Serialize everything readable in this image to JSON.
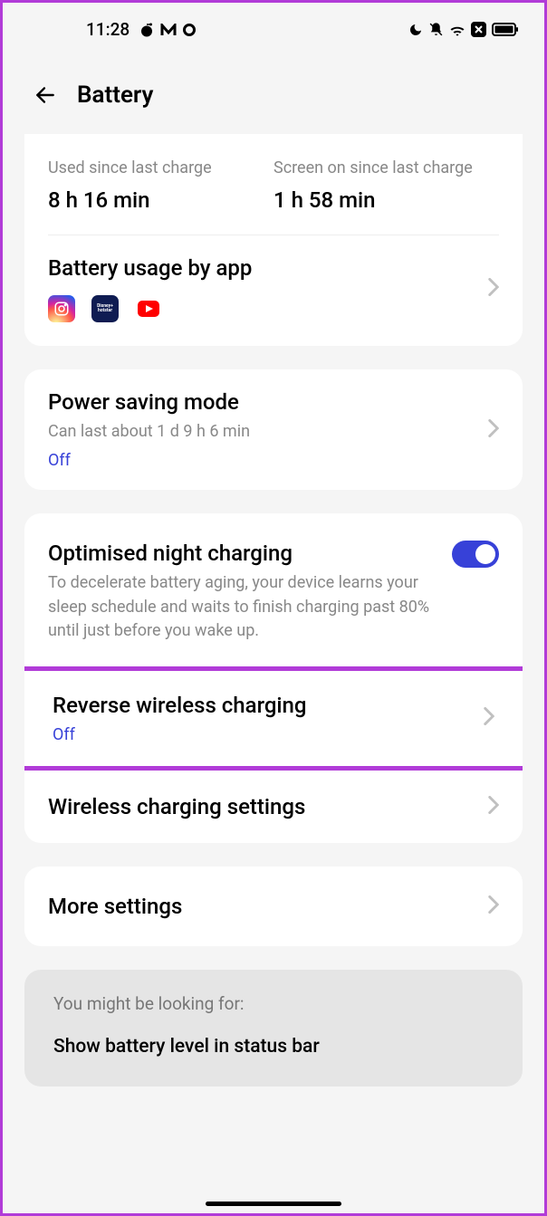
{
  "statusBar": {
    "time": "11:28"
  },
  "header": {
    "title": "Battery"
  },
  "usage": {
    "sinceLastCharge": {
      "label": "Used since last charge",
      "value": "8 h 16 min"
    },
    "screenOn": {
      "label": "Screen on since last charge",
      "value": "1 h 58 min"
    }
  },
  "batteryUsage": {
    "title": "Battery usage by app"
  },
  "powerSaving": {
    "title": "Power saving mode",
    "sub": "Can last about 1 d 9 h 6 min",
    "status": "Off"
  },
  "optimised": {
    "title": "Optimised night charging",
    "sub": "To decelerate battery aging, your device learns your sleep schedule and waits to finish charging past 80% until just before you wake up."
  },
  "reverse": {
    "title": "Reverse wireless charging",
    "status": "Off"
  },
  "wirelessSettings": {
    "title": "Wireless charging settings"
  },
  "moreSettings": {
    "title": "More settings"
  },
  "suggestion": {
    "label": "You might be looking for:",
    "title": "Show battery level in status bar"
  }
}
